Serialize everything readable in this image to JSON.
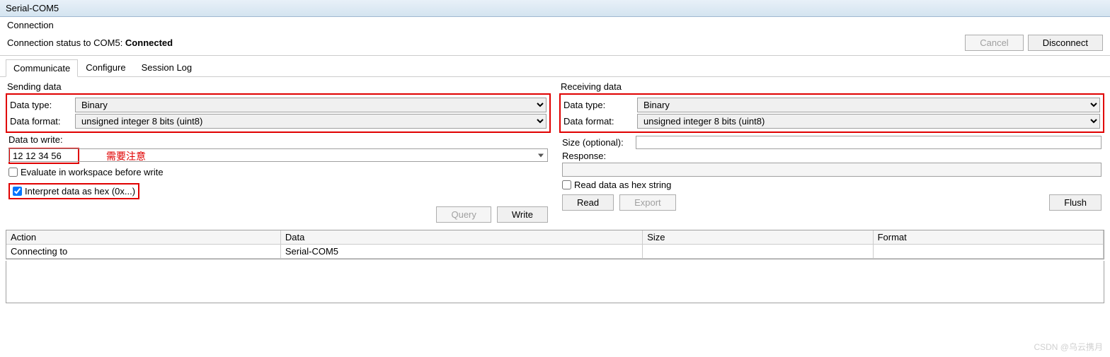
{
  "title": "Serial-COM5",
  "connection": {
    "header": "Connection",
    "status_prefix": "Connection status to COM5: ",
    "status_value": "Connected",
    "cancel": "Cancel",
    "disconnect": "Disconnect"
  },
  "tabs": [
    "Communicate",
    "Configure",
    "Session Log"
  ],
  "sending": {
    "legend": "Sending data",
    "data_type_label": "Data type:",
    "data_type_value": "Binary",
    "data_format_label": "Data format:",
    "data_format_value": "unsigned integer 8 bits (uint8)",
    "data_to_write_label": "Data to write:",
    "data_to_write_value": "12 12 34 56",
    "note": "需要注意",
    "evaluate_label": "Evaluate in workspace before write",
    "interpret_label": "Interpret data as hex (0x...)",
    "query": "Query",
    "write": "Write"
  },
  "receiving": {
    "legend": "Receiving data",
    "data_type_label": "Data type:",
    "data_type_value": "Binary",
    "data_format_label": "Data format:",
    "data_format_value": "unsigned integer 8 bits (uint8)",
    "size_label": "Size (optional):",
    "size_value": "",
    "response_label": "Response:",
    "read_hex_label": "Read data as hex string",
    "read": "Read",
    "export": "Export",
    "flush": "Flush"
  },
  "table": {
    "headers": [
      "Action",
      "Data",
      "Size",
      "Format"
    ],
    "row": {
      "action": "Connecting to",
      "data": "Serial-COM5",
      "size": "",
      "format": ""
    }
  },
  "watermark": "CSDN @乌云携月"
}
